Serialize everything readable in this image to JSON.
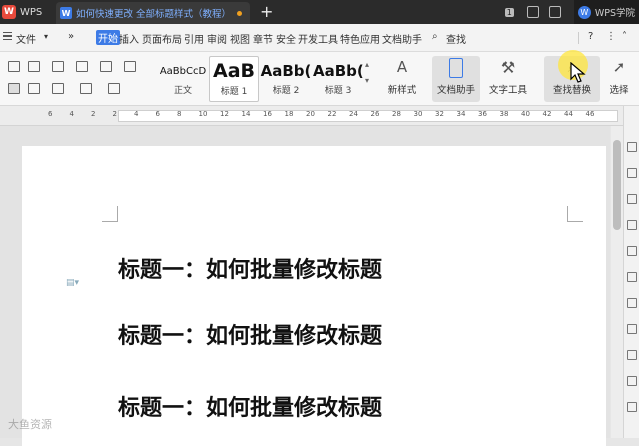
{
  "titlebar": {
    "app_label": "WPS",
    "doc_tab_title": "如何快速更改 全部标题样式（教程）",
    "account_label": "WPS学院",
    "badge": "1"
  },
  "menubar": {
    "file": "文件",
    "more": "»",
    "tabs": [
      "开始",
      "插入",
      "页面布局",
      "引用",
      "审阅",
      "视图",
      "章节",
      "安全",
      "开发工具",
      "特色应用",
      "文档助手"
    ],
    "search": "查找"
  },
  "ribbon": {
    "styles": [
      {
        "sample": "AaBbCcD",
        "label": "正文"
      },
      {
        "sample": "AaB",
        "label": "标题 1"
      },
      {
        "sample": "AaBb(",
        "label": "标题 2"
      },
      {
        "sample": "AaBb(",
        "label": "标题 3"
      }
    ],
    "new_style": "新样式",
    "doc_helper": "文档助手",
    "text_tools": "文字工具",
    "find_replace": "查找替换",
    "select": "选择"
  },
  "ruler": {
    "numbers": [
      "6",
      "4",
      "2",
      "2",
      "4",
      "6",
      "8",
      "10",
      "12",
      "14",
      "16",
      "18",
      "20",
      "22",
      "24",
      "26",
      "28",
      "30",
      "32",
      "34",
      "36",
      "38",
      "40",
      "42",
      "44",
      "46"
    ]
  },
  "document": {
    "headings": [
      "标题一：如何批量修改标题",
      "标题一：如何批量修改标题",
      "标题一：如何批量修改标题"
    ]
  },
  "watermark": "大鱼资源"
}
